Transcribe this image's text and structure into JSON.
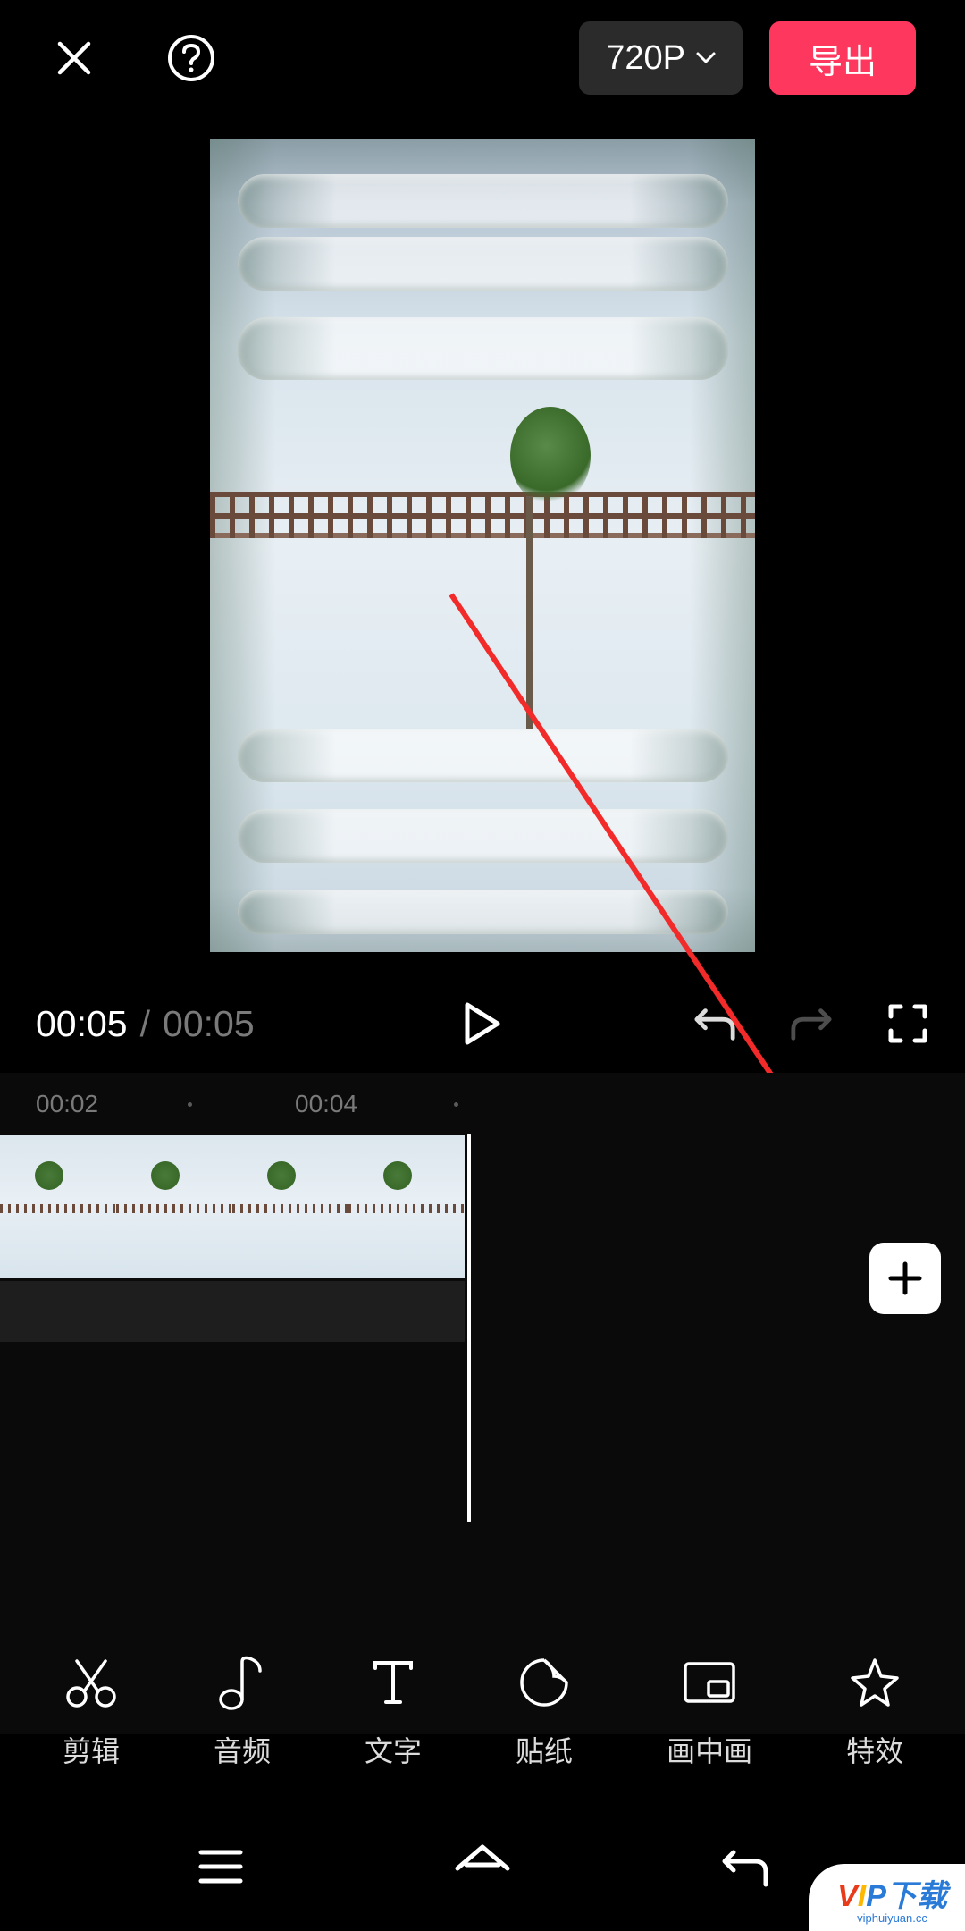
{
  "header": {
    "resolution_label": "720P",
    "export_label": "导出"
  },
  "playback": {
    "current_time": "00:05",
    "separator": "/",
    "total_time": "00:05"
  },
  "timeline": {
    "labels": [
      "00:02",
      "00:04"
    ]
  },
  "tools": [
    {
      "id": "cut",
      "label": "剪辑"
    },
    {
      "id": "audio",
      "label": "音频"
    },
    {
      "id": "text",
      "label": "文字"
    },
    {
      "id": "sticker",
      "label": "贴纸"
    },
    {
      "id": "pip",
      "label": "画中画"
    },
    {
      "id": "effects",
      "label": "特效"
    }
  ],
  "watermark": {
    "text": "VIP下载",
    "subtext": "viphuiyuan.cc"
  }
}
